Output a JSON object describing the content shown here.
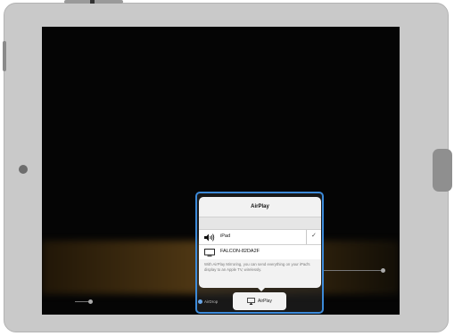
{
  "popup": {
    "title": "AirPlay",
    "devices": [
      {
        "label": "iPad",
        "icon": "speaker-icon",
        "selected": true
      },
      {
        "label": "FALCON-82DA2F",
        "icon": "tv-icon",
        "selected": false
      }
    ],
    "checkmark": "✓",
    "description": "With AirPlay Mirroring, you can send everything on your iPad's display to an Apple TV, wirelessly."
  },
  "control_center": {
    "airdrop_label": "AirDrop",
    "airplay_label": "AirPlay"
  },
  "colors": {
    "accent": "#3c8ad9",
    "screen": "#050505",
    "device_body": "#c9c9c9"
  }
}
